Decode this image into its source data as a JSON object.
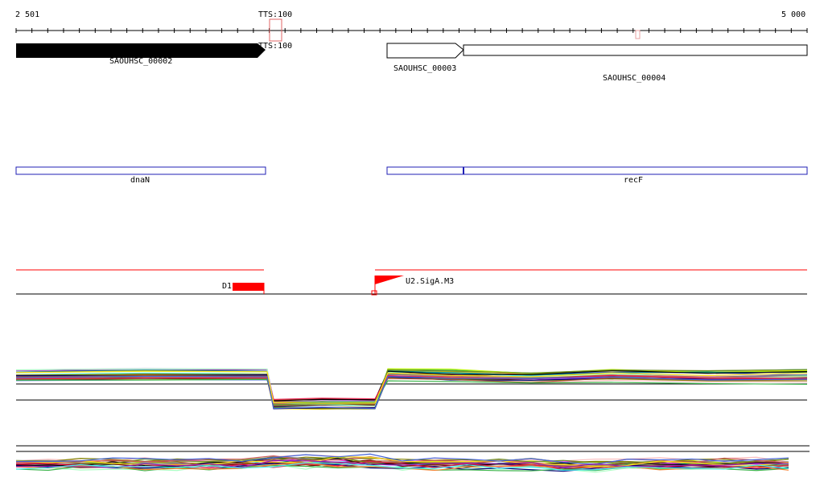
{
  "ruler": {
    "start_label": "2 501",
    "end_label": "5 000"
  },
  "tick_marker": {
    "label": "TTS:100"
  },
  "genes": {
    "g2_label": "SAOUHSC_00002",
    "g3_label": "SAOUHSC_00003",
    "g4_label": "SAOUHSC_00004"
  },
  "annotations": {
    "dnaN_label": "dnaN",
    "recF_label": "recF"
  },
  "features": {
    "d1_label": "D1",
    "u2_label": "U2.SigA.M3"
  },
  "colors": {
    "gene_fill": "#000000",
    "annotation_stroke": "#1f1fb4",
    "feature_red": "#ff0000",
    "marker_pink": "#e87b7b"
  }
}
